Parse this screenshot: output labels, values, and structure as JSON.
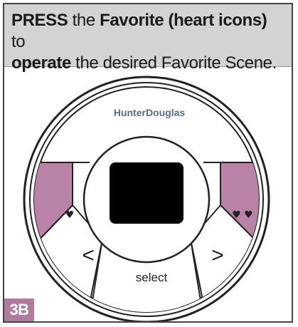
{
  "instruction": {
    "press": "PRESS",
    "t1": " the ",
    "favorite": "Favorite (heart icons)",
    "t2": " to",
    "operate": "operate",
    "t3": " the desired Favorite Scene."
  },
  "remote": {
    "brand": "HunterDouglas",
    "left_favorite": "♥",
    "right_favorite": "♥ ♥",
    "left_arrow": "<",
    "right_arrow": ">",
    "select": "select"
  },
  "step": "3B",
  "colors": {
    "favorite_fill": "#b983a8",
    "badge": "#b27a9c",
    "brand_text": "#5b6c86",
    "header_bg": "#d3d3d3"
  }
}
